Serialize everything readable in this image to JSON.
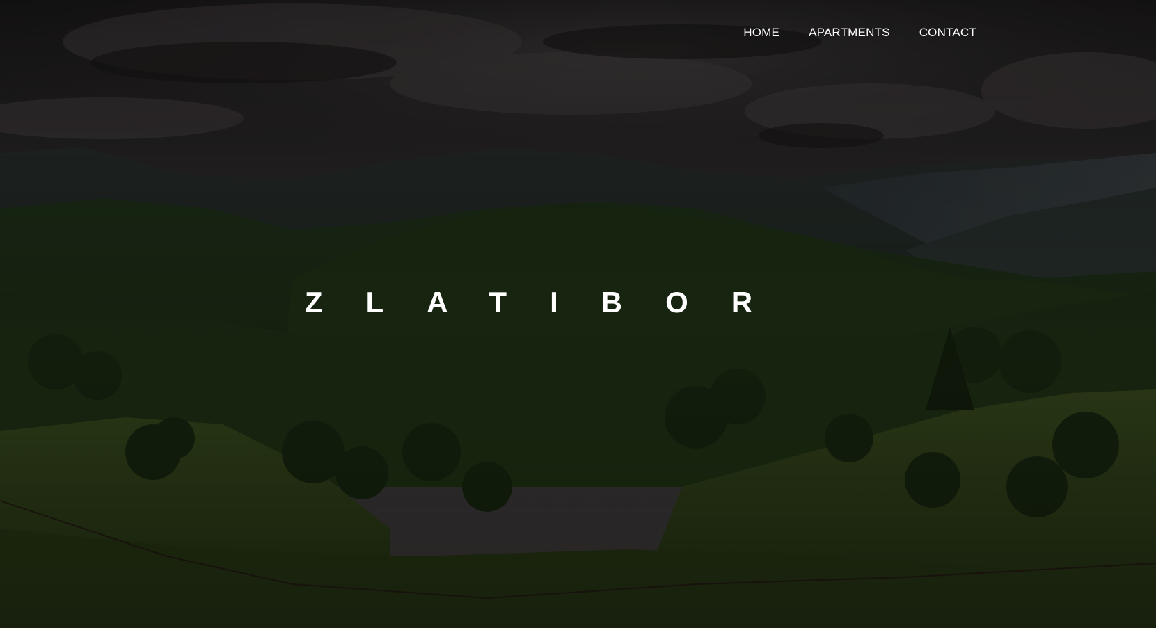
{
  "nav": {
    "items": [
      {
        "label": "HOME"
      },
      {
        "label": "APARTMENTS"
      },
      {
        "label": "CONTACT"
      }
    ]
  },
  "hero": {
    "title": "ZLATIBOR",
    "image": "mountain-landscape-photo"
  },
  "colors": {
    "text": "#ffffff",
    "overlay": "#000000",
    "sky": "#3a3535",
    "mountains": "#2f3a34",
    "forest": "#2a3a1e",
    "meadow": "#4a5e2a"
  }
}
